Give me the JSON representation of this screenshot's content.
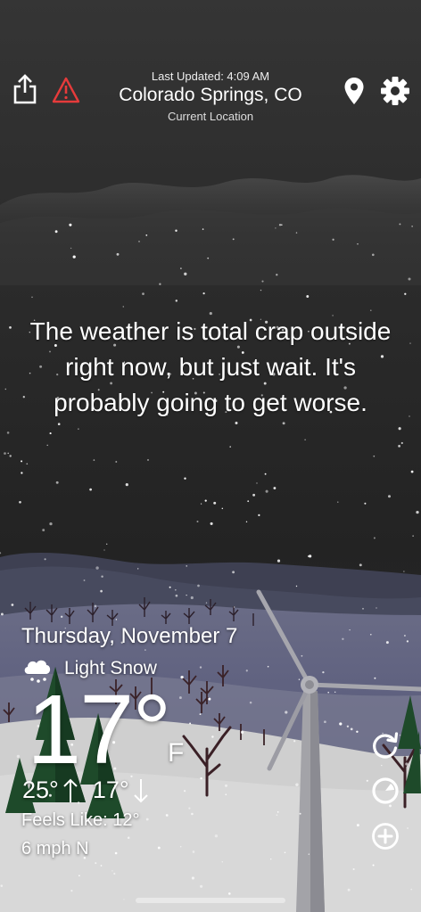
{
  "header": {
    "last_updated": "Last Updated: 4:09 AM",
    "city": "Colorado Springs, CO",
    "location_label": "Current Location",
    "icons": [
      "share-icon",
      "warning-icon",
      "location-pin-icon",
      "settings-gear-icon"
    ]
  },
  "headline": "The weather is total crap outside right now, but just wait. It's probably going to get worse.",
  "current": {
    "date": "Thursday, November 7",
    "condition_icon": "snow-cloud-icon",
    "condition": "Light Snow",
    "temperature": "17°",
    "unit": "F",
    "high": "25°",
    "low": "17°",
    "feels_like": "Feels Like: 12°",
    "wind": "6 mph N"
  },
  "actions": {
    "icons": [
      "refresh-icon",
      "radar-icon",
      "add-icon"
    ]
  },
  "colors": {
    "sky_top": "#2e2e2e",
    "sky_mid": "#232323",
    "mountains": "#4b4d5c",
    "snow_ground": "#d2d2d2",
    "trees": "#1f4d2c",
    "warning": "#e53b3b"
  }
}
